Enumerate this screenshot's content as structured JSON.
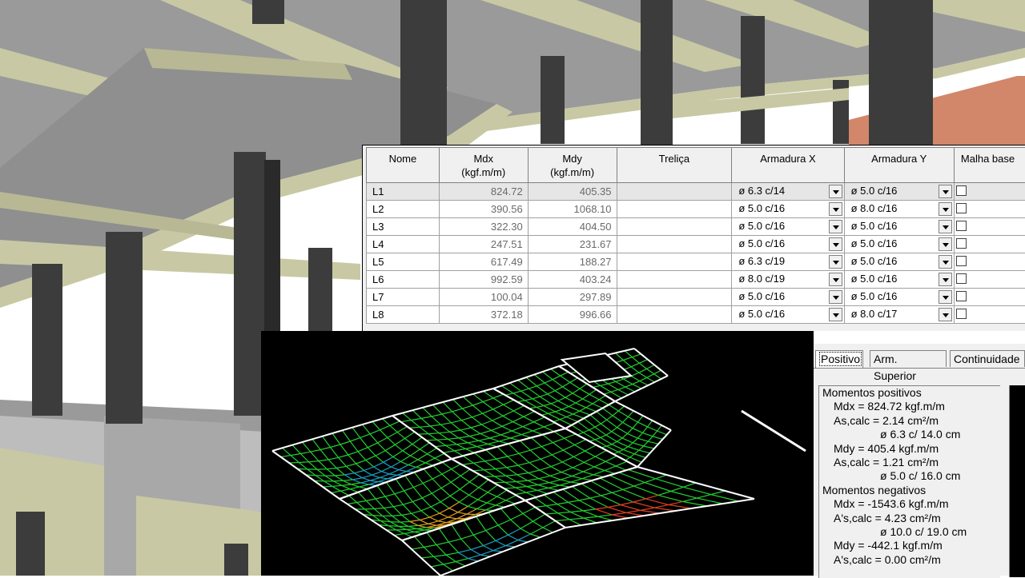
{
  "table": {
    "columns": [
      {
        "l1": "Nome",
        "l2": ""
      },
      {
        "l1": "Mdx",
        "l2": "(kgf.m/m)"
      },
      {
        "l1": "Mdy",
        "l2": "(kgf.m/m)"
      },
      {
        "l1": "Treliça",
        "l2": ""
      },
      {
        "l1": "Armadura X",
        "l2": ""
      },
      {
        "l1": "Armadura Y",
        "l2": ""
      },
      {
        "l1": "Malha base",
        "l2": ""
      }
    ],
    "rows": [
      {
        "nome": "L1",
        "mdx": "824.72",
        "mdy": "405.35",
        "trelica": "",
        "arm_x": "ø 6.3 c/14",
        "arm_y": "ø 5.0 c/16",
        "malha": false
      },
      {
        "nome": "L2",
        "mdx": "390.56",
        "mdy": "1068.10",
        "trelica": "",
        "arm_x": "ø 5.0 c/16",
        "arm_y": "ø 8.0 c/16",
        "malha": false
      },
      {
        "nome": "L3",
        "mdx": "322.30",
        "mdy": "404.50",
        "trelica": "",
        "arm_x": "ø 5.0 c/16",
        "arm_y": "ø 5.0 c/16",
        "malha": false
      },
      {
        "nome": "L4",
        "mdx": "247.51",
        "mdy": "231.67",
        "trelica": "",
        "arm_x": "ø 5.0 c/16",
        "arm_y": "ø 5.0 c/16",
        "malha": false
      },
      {
        "nome": "L5",
        "mdx": "617.49",
        "mdy": "188.27",
        "trelica": "",
        "arm_x": "ø 6.3 c/19",
        "arm_y": "ø 5.0 c/16",
        "malha": false
      },
      {
        "nome": "L6",
        "mdx": "992.59",
        "mdy": "403.24",
        "trelica": "",
        "arm_x": "ø 8.0 c/19",
        "arm_y": "ø 5.0 c/16",
        "malha": false
      },
      {
        "nome": "L7",
        "mdx": "100.04",
        "mdy": "297.89",
        "trelica": "",
        "arm_x": "ø 5.0 c/16",
        "arm_y": "ø 5.0 c/16",
        "malha": false
      },
      {
        "nome": "L8",
        "mdx": "372.18",
        "mdy": "996.66",
        "trelica": "",
        "arm_x": "ø 5.0 c/16",
        "arm_y": "ø 8.0 c/17",
        "malha": false
      }
    ],
    "selected_row": 0
  },
  "tabs": [
    {
      "label": "Positivo",
      "active": true
    },
    {
      "label": "Arm. Superior",
      "active": false
    },
    {
      "label": "Continuidade",
      "active": false
    }
  ],
  "results": {
    "lines": [
      {
        "text": "Momentos positivos",
        "level": 0
      },
      {
        "text": "Mdx = 824.72 kgf.m/m",
        "level": 1
      },
      {
        "text": "As,calc = 2.14 cm²/m",
        "level": 1
      },
      {
        "text": "ø 6.3 c/ 14.0 cm",
        "level": 2
      },
      {
        "text": "Mdy = 405.4 kgf.m/m",
        "level": 1
      },
      {
        "text": "As,calc = 1.21 cm²/m",
        "level": 1
      },
      {
        "text": "ø 5.0 c/ 16.0 cm",
        "level": 2
      },
      {
        "text": "Momentos negativos",
        "level": 0
      },
      {
        "text": "Mdx = -1543.6 kgf.m/m",
        "level": 1
      },
      {
        "text": "A's,calc = 4.23 cm²/m",
        "level": 1
      },
      {
        "text": "ø 10.0 c/ 19.0 cm",
        "level": 2
      },
      {
        "text": "Mdy = -442.1 kgf.m/m",
        "level": 1
      },
      {
        "text": "A's,calc = 0.00 cm²/m",
        "level": 1
      }
    ]
  },
  "colors": {
    "slab_top": "#9a9a9a",
    "beam": "#c8c8a4",
    "column": "#3c3c3c",
    "mesh_green": "#22d030",
    "mesh_white": "#ffffff",
    "brick": "#d2876a"
  }
}
